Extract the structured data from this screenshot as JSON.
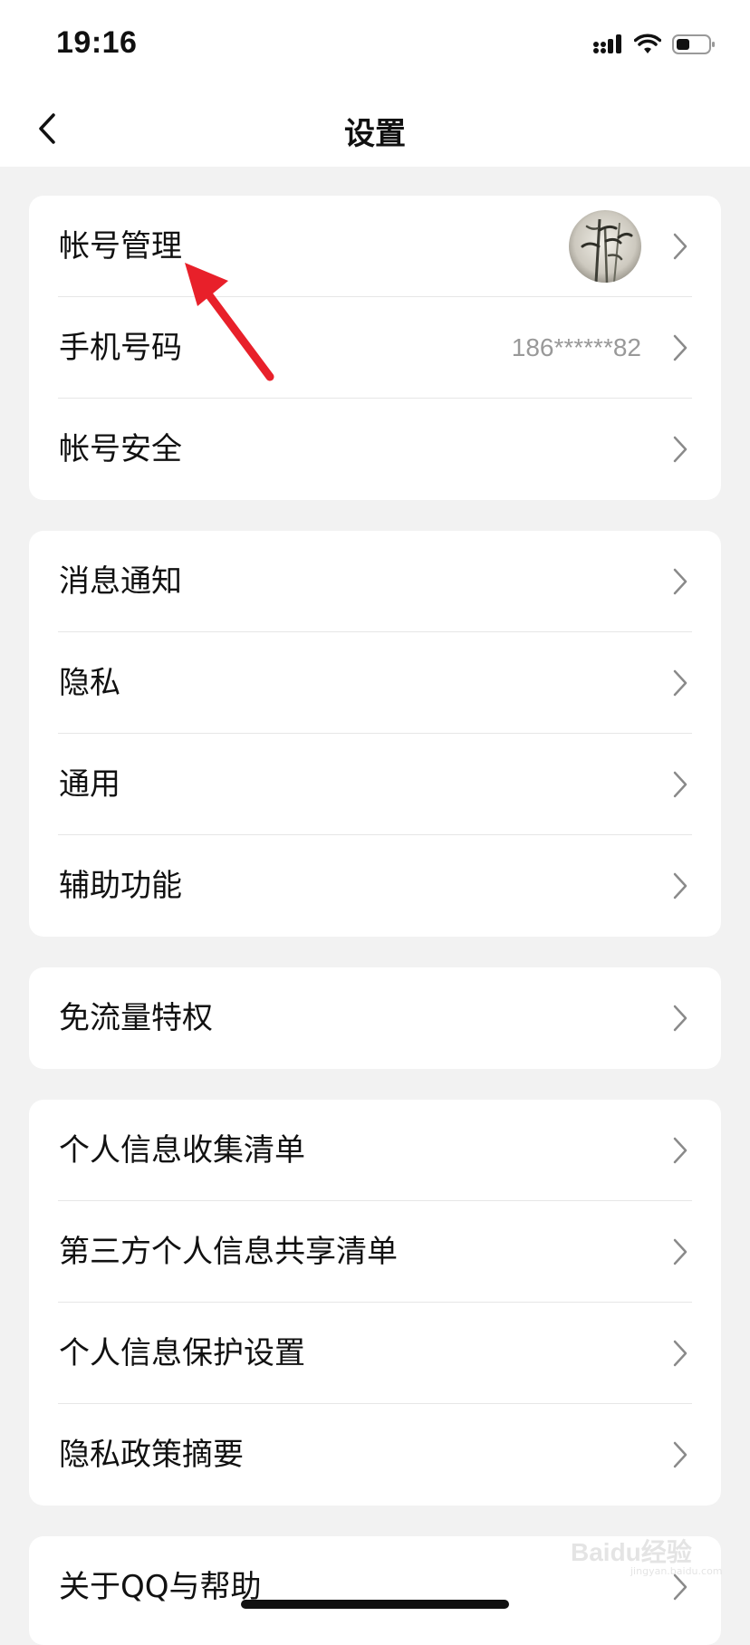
{
  "status_bar": {
    "time": "19:16"
  },
  "nav": {
    "title": "设置"
  },
  "sections": [
    {
      "items": [
        {
          "label": "帐号管理",
          "has_avatar": true
        },
        {
          "label": "手机号码",
          "value": "186******82"
        },
        {
          "label": "帐号安全"
        }
      ]
    },
    {
      "items": [
        {
          "label": "消息通知"
        },
        {
          "label": "隐私"
        },
        {
          "label": "通用"
        },
        {
          "label": "辅助功能"
        }
      ]
    },
    {
      "items": [
        {
          "label": "免流量特权"
        }
      ]
    },
    {
      "items": [
        {
          "label": "个人信息收集清单"
        },
        {
          "label": "第三方个人信息共享清单"
        },
        {
          "label": "个人信息保护设置"
        },
        {
          "label": "隐私政策摘要"
        }
      ]
    },
    {
      "items": [
        {
          "label": "关于QQ与帮助"
        }
      ]
    }
  ],
  "icons": {
    "back": "chevron-left-icon",
    "row_arrow": "chevron-right-icon",
    "signal": "cellular-signal-icon",
    "wifi": "wifi-icon",
    "battery": "battery-icon"
  },
  "annotation_color": "#e8202a",
  "watermark": {
    "text": "Baidu经验",
    "sub": "jingyan.baidu.com"
  }
}
